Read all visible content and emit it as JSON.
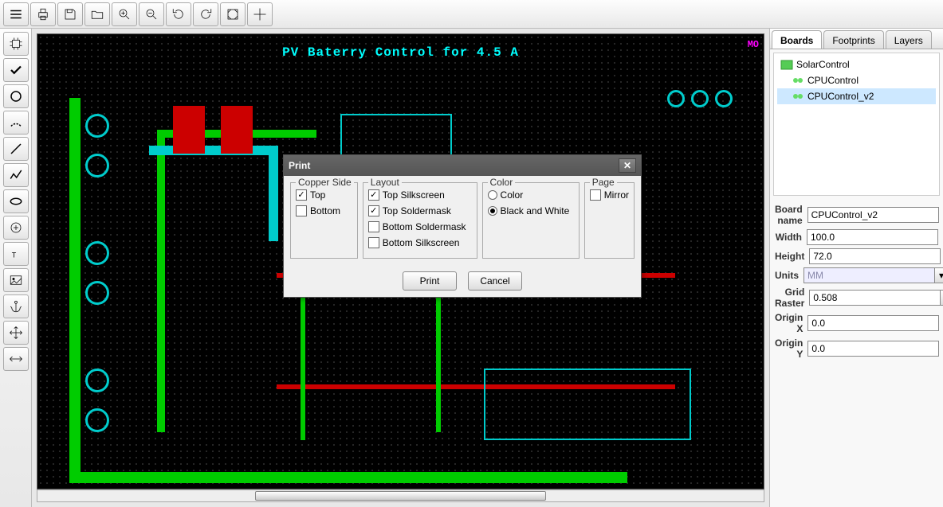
{
  "toolbar_top": [
    "menu",
    "print",
    "save",
    "open",
    "zoom-in",
    "zoom-out",
    "rotate-ccw",
    "rotate-cw",
    "fit",
    "crosshair"
  ],
  "toolbar_left": [
    "chip",
    "check",
    "circle",
    "arc",
    "line",
    "polyline",
    "ellipse",
    "add-circle",
    "text",
    "image",
    "anchor",
    "move",
    "resize-h"
  ],
  "canvas": {
    "title": "PV Baterry Control for 4.5 A",
    "corner": "MO"
  },
  "dialog": {
    "title": "Print",
    "groups": {
      "copper_side": {
        "legend": "Copper Side",
        "items": [
          {
            "label": "Top",
            "checked": true
          },
          {
            "label": "Bottom",
            "checked": false
          }
        ]
      },
      "layout": {
        "legend": "Layout",
        "items": [
          {
            "label": "Top Silkscreen",
            "checked": true
          },
          {
            "label": "Top Soldermask",
            "checked": true
          },
          {
            "label": "Bottom Soldermask",
            "checked": false
          },
          {
            "label": "Bottom Silkscreen",
            "checked": false
          }
        ]
      },
      "color": {
        "legend": "Color",
        "items": [
          {
            "label": "Color",
            "checked": false
          },
          {
            "label": "Black and White",
            "checked": true
          }
        ]
      },
      "page": {
        "legend": "Page",
        "items": [
          {
            "label": "Mirror",
            "checked": false
          }
        ]
      }
    },
    "buttons": {
      "print": "Print",
      "cancel": "Cancel"
    }
  },
  "tabs": [
    "Boards",
    "Footprints",
    "Layers"
  ],
  "active_tab": 0,
  "tree": {
    "root": "SolarControl",
    "children": [
      "CPUControl",
      "CPUControl_v2"
    ],
    "selected": "CPUControl_v2"
  },
  "props": {
    "board_name": {
      "label": "Board name",
      "value": "CPUControl_v2"
    },
    "width": {
      "label": "Width",
      "value": "100.0"
    },
    "height": {
      "label": "Height",
      "value": "72.0"
    },
    "units": {
      "label": "Units",
      "value": "MM"
    },
    "grid_raster": {
      "label": "Grid Raster",
      "value": "0.508"
    },
    "origin_x": {
      "label": "Origin X",
      "value": "0.0"
    },
    "origin_y": {
      "label": "Origin Y",
      "value": "0.0"
    }
  }
}
